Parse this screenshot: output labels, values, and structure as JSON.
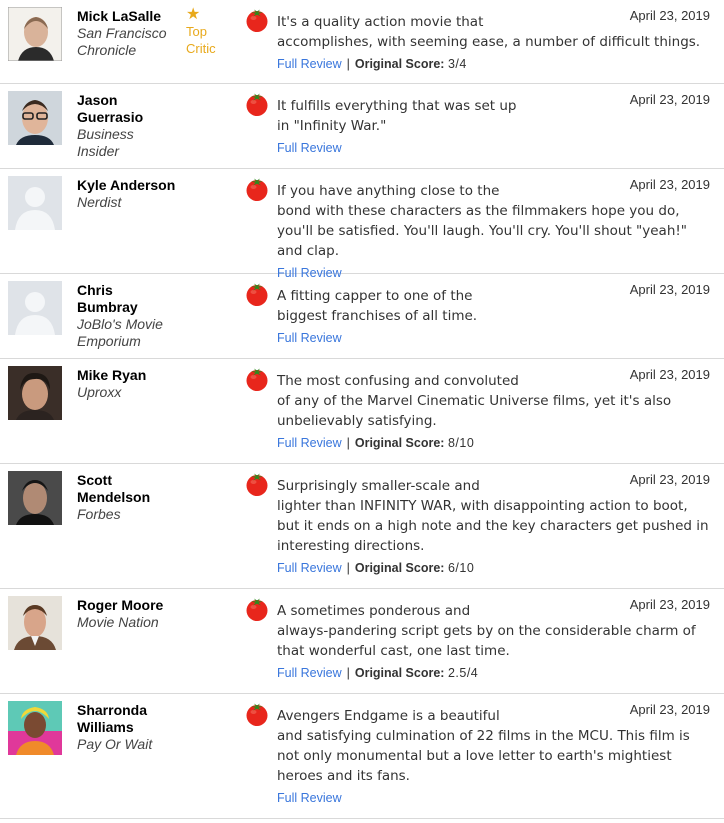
{
  "colors": {
    "link": "#3976dc",
    "top_critic": "#e8a91c",
    "tomato_red": "#e8261c",
    "tomato_leaf": "#2e8b1e",
    "divider": "#d9d9d9"
  },
  "icons": {
    "fresh": "fresh-tomato-icon",
    "top_critic": "star-icon"
  },
  "labels": {
    "full_review": "Full Review",
    "separator": "|",
    "original_score": "Original Score:",
    "top_critic_line1": "Top",
    "top_critic_line2": "Critic"
  },
  "reviews": [
    {
      "name": "Mick LaSalle",
      "publication": "San Francisco Chronicle",
      "top_critic": true,
      "date": "April 23, 2019",
      "quote": "It's a quality action movie that accomplishes, with seeming ease, a number of difficult things.",
      "original_score": "3/4",
      "avatar": "photo"
    },
    {
      "name": "Jason Guerrasio",
      "publication": "Business Insider",
      "top_critic": false,
      "date": "April 23, 2019",
      "quote": "It fulfills everything that was set up in \"Infinity War.\"",
      "original_score": "",
      "avatar": "photo"
    },
    {
      "name": "Kyle Anderson",
      "publication": "Nerdist",
      "top_critic": false,
      "date": "April 23, 2019",
      "quote": "If you have anything close to the bond with these characters as the filmmakers hope you do, you'll be satisfied. You'll laugh. You'll cry. You'll shout \"yeah!\" and clap.",
      "original_score": "",
      "avatar": "placeholder"
    },
    {
      "name": "Chris Bumbray",
      "publication": "JoBlo's Movie Emporium",
      "top_critic": false,
      "date": "April 23, 2019",
      "quote": "A fitting capper to one of the biggest franchises of all time.",
      "original_score": "",
      "avatar": "placeholder"
    },
    {
      "name": "Mike Ryan",
      "publication": "Uproxx",
      "top_critic": false,
      "date": "April 23, 2019",
      "quote": "The most confusing and convoluted of any of the Marvel Cinematic Universe films, yet it's also unbelievably satisfying.",
      "original_score": "8/10",
      "avatar": "photo"
    },
    {
      "name": "Scott Mendelson",
      "publication": "Forbes",
      "top_critic": false,
      "date": "April 23, 2019",
      "quote": "Surprisingly smaller-scale and lighter than INFINITY WAR, with disappointing action to boot, but it ends on a high note and the key characters get pushed in interesting directions.",
      "original_score": "6/10",
      "avatar": "photo"
    },
    {
      "name": "Roger Moore",
      "publication": "Movie Nation",
      "top_critic": false,
      "date": "April 23, 2019",
      "quote": "A sometimes ponderous and always-pandering script gets by on the considerable charm of that wonderful cast, one last time.",
      "original_score": "2.5/4",
      "avatar": "photo"
    },
    {
      "name": "Sharronda Williams",
      "publication": "Pay Or Wait",
      "top_critic": false,
      "date": "April 23, 2019",
      "quote": "Avengers Endgame is a beautiful and satisfying culmination of 22 films in the MCU. This film is not only monumental but a love letter to earth's mightiest heroes and its fans.",
      "original_score": "",
      "avatar": "photo"
    }
  ]
}
